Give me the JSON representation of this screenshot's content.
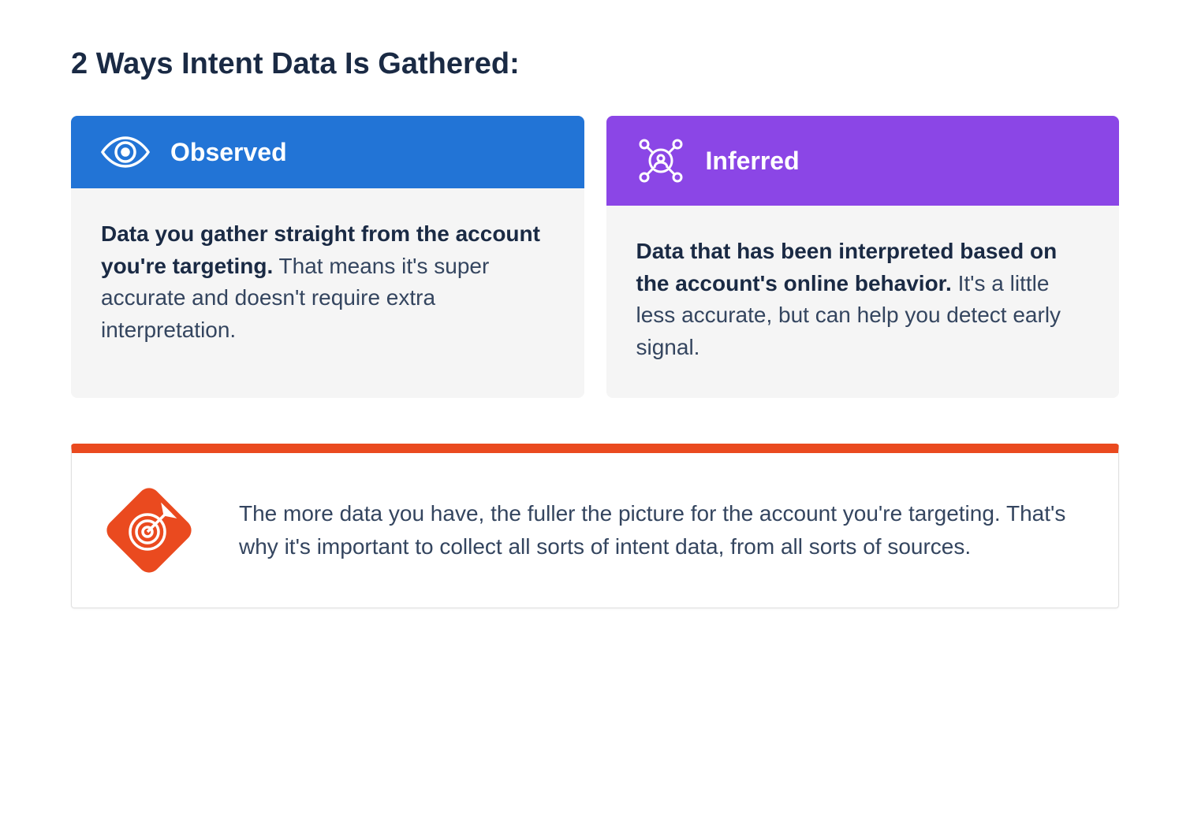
{
  "title": "2 Ways Intent Data Is Gathered:",
  "cards": {
    "observed": {
      "header": "Observed",
      "body_strong": "Data you gather straight from the account you're targeting.",
      "body_light": " That means it's super accurate and doesn't require extra interpretation."
    },
    "inferred": {
      "header": "Inferred",
      "body_strong": "Data that has been interpreted based on the account's online behavior.",
      "body_light": " It's a little less accurate, but can help you detect early signal."
    }
  },
  "callout": {
    "text": "The more data you have, the fuller the picture for the account you're targeting. That's why it's important to collect all sorts of intent data, from all sorts of sources."
  },
  "colors": {
    "blue": "#2274d6",
    "purple": "#8b46e6",
    "orange": "#ea4a1f",
    "dark_navy": "#1a2a44",
    "muted_navy": "#34455f",
    "light_gray": "#f5f5f5"
  }
}
